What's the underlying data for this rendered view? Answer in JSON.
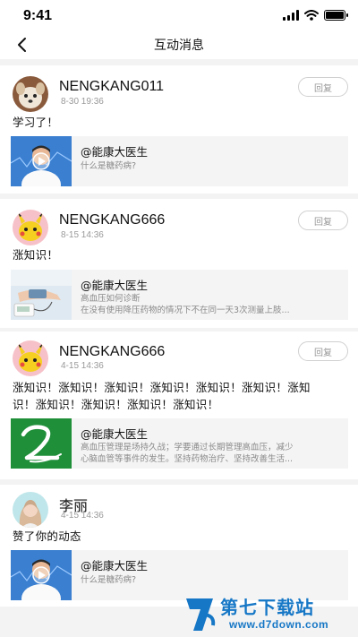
{
  "status": {
    "time": "9:41"
  },
  "header": {
    "title": "互动消息"
  },
  "messages": [
    {
      "username": "NENGKANG011",
      "time": "8-30 19:36",
      "reply_label": "回复",
      "comment": "学习了！",
      "avatar": "dog-avatar",
      "quote": {
        "author": "@能康大医生",
        "lines": [
          "什么是糖药病?"
        ],
        "thumb": "video-doctor-thumb"
      }
    },
    {
      "username": "NENGKANG666",
      "time": "8-15 14:36",
      "reply_label": "回复",
      "comment": "涨知识！",
      "avatar": "pikachu-avatar",
      "quote": {
        "author": "@能康大医生",
        "lines": [
          "高血压如何诊断",
          "在没有使用降压药物的情况下不在同一天3次测量上肢..."
        ],
        "thumb": "blood-pressure-thumb"
      }
    },
    {
      "username": "NENGKANG666",
      "time": "4-15 14:36",
      "reply_label": "回复",
      "comment_lines": [
        "涨知识！涨知识！涨知识！涨知识！涨知识！涨知识！涨知",
        "识！涨知识！涨知识！涨知识！涨知识！"
      ],
      "avatar": "pikachu-avatar",
      "quote": {
        "author": "@能康大医生",
        "lines": [
          "高血压管理是场持久战；学要通过长期管理高血压，减少",
          "心脑血管等事件的发生。坚持药物治疗、坚持改善生活..."
        ],
        "thumb": "green-logo-thumb"
      }
    },
    {
      "username": "李丽",
      "time": "4-15 14:36",
      "comment": "赞了你的动态",
      "avatar": "girl-avatar",
      "quote": {
        "author": "@能康大医生",
        "lines": [
          "什么是糖药病?"
        ],
        "thumb": "video-doctor-thumb"
      }
    }
  ],
  "watermark": {
    "name": "第七下载站",
    "url": "www.d7down.com"
  },
  "colors": {
    "accent": "#1677c6",
    "background": "#f3f3f3",
    "muted": "#999999"
  }
}
